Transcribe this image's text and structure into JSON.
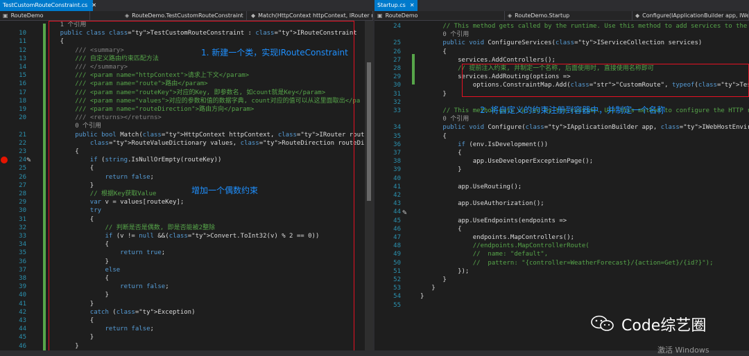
{
  "left": {
    "tab_title": "TestCustomRouteConstraint.cs",
    "nav_project": "RouteDemo",
    "nav_class": "RouteDemo.TestCustomRouteConstraint",
    "nav_method": "Match(HttpContext httpContext, IRouter route,",
    "lines": [
      {
        "n": "",
        "text": "1 个引用",
        "cls": "ref",
        "indent": 4
      },
      {
        "n": "10",
        "text": "public class TestCustomRouteConstraint : IRouteConstraint",
        "cls": "",
        "indent": 4
      },
      {
        "n": "11",
        "text": "{",
        "cls": "",
        "indent": 4
      },
      {
        "n": "12",
        "text": "/// <summary>",
        "cls": "xml",
        "indent": 8
      },
      {
        "n": "13",
        "text": "/// 自定义路由约束匹配方法",
        "cls": "cm",
        "indent": 8
      },
      {
        "n": "14",
        "text": "/// </summary>",
        "cls": "xml",
        "indent": 8
      },
      {
        "n": "15",
        "text": "/// <param name=\"httpContext\">请求上下文</param>",
        "cls": "cm",
        "indent": 8
      },
      {
        "n": "16",
        "text": "/// <param name=\"route\">路由</param>",
        "cls": "cm",
        "indent": 8
      },
      {
        "n": "17",
        "text": "/// <param name=\"routeKey\">对应的Key, 即参数名, 如count就是Key</param>",
        "cls": "cm",
        "indent": 8
      },
      {
        "n": "18",
        "text": "/// <param name=\"values\">对应的参数和值的数据字典, count对应的值可以从这里面取出</pa",
        "cls": "cm",
        "indent": 8
      },
      {
        "n": "19",
        "text": "/// <param name=\"routeDirection\">路由方向</param>",
        "cls": "cm",
        "indent": 8
      },
      {
        "n": "20",
        "text": "/// <returns></returns>",
        "cls": "xml",
        "indent": 8
      },
      {
        "n": "",
        "text": "0 个引用",
        "cls": "ref",
        "indent": 8
      },
      {
        "n": "21",
        "text": "public bool Match(HttpContext httpContext, IRouter route, string routeKey,",
        "cls": "",
        "indent": 8
      },
      {
        "n": "22",
        "text": "    RouteValueDictionary values, RouteDirection routeDirection)",
        "cls": "",
        "indent": 8
      },
      {
        "n": "23",
        "text": "{",
        "cls": "",
        "indent": 8
      },
      {
        "n": "24",
        "text": "if (string.IsNullOrEmpty(routeKey))",
        "cls": "",
        "indent": 12
      },
      {
        "n": "25",
        "text": "{",
        "cls": "",
        "indent": 12
      },
      {
        "n": "26",
        "text": "    return false;",
        "cls": "",
        "indent": 12
      },
      {
        "n": "27",
        "text": "}",
        "cls": "",
        "indent": 12
      },
      {
        "n": "28",
        "text": "// 根据Key获取Value",
        "cls": "cm",
        "indent": 12
      },
      {
        "n": "29",
        "text": "var v = values[routeKey];",
        "cls": "",
        "indent": 12
      },
      {
        "n": "30",
        "text": "try",
        "cls": "",
        "indent": 12
      },
      {
        "n": "31",
        "text": "{",
        "cls": "",
        "indent": 12
      },
      {
        "n": "32",
        "text": "    // 判断是否是偶数, 即是否能被2整除",
        "cls": "cm",
        "indent": 12
      },
      {
        "n": "33",
        "text": "    if (v != null &&(Convert.ToInt32(v) % 2 == 0))",
        "cls": "",
        "indent": 12
      },
      {
        "n": "34",
        "text": "    {",
        "cls": "",
        "indent": 12
      },
      {
        "n": "35",
        "text": "        return true;",
        "cls": "",
        "indent": 12
      },
      {
        "n": "36",
        "text": "    }",
        "cls": "",
        "indent": 12
      },
      {
        "n": "37",
        "text": "    else",
        "cls": "",
        "indent": 12
      },
      {
        "n": "38",
        "text": "    {",
        "cls": "",
        "indent": 12
      },
      {
        "n": "39",
        "text": "        return false;",
        "cls": "",
        "indent": 12
      },
      {
        "n": "40",
        "text": "    }",
        "cls": "",
        "indent": 12
      },
      {
        "n": "41",
        "text": "}",
        "cls": "",
        "indent": 12
      },
      {
        "n": "42",
        "text": "catch (Exception)",
        "cls": "",
        "indent": 12
      },
      {
        "n": "43",
        "text": "{",
        "cls": "",
        "indent": 12
      },
      {
        "n": "44",
        "text": "    return false;",
        "cls": "",
        "indent": 12
      },
      {
        "n": "45",
        "text": "}",
        "cls": "",
        "indent": 12
      },
      {
        "n": "46",
        "text": "}",
        "cls": "",
        "indent": 8
      }
    ],
    "annotation_1": "1. 新建一个类，实现IRouteConstraint",
    "annotation_2": "增加一个偶数约束"
  },
  "right": {
    "tab_title": "Startup.cs",
    "nav_project": "RouteDemo",
    "nav_class": "RouteDemo.Startup",
    "nav_method": "Configure(IApplicationBuilder app, IWebHost",
    "lines": [
      {
        "n": "24",
        "text": "// This method gets called by the runtime. Use this method to add services to the conta",
        "cls": "cm",
        "indent": 6
      },
      {
        "n": "",
        "text": "0 个引用",
        "cls": "ref",
        "indent": 6
      },
      {
        "n": "25",
        "text": "public void ConfigureServices(IServiceCollection services)",
        "cls": "",
        "indent": 6
      },
      {
        "n": "26",
        "text": "{",
        "cls": "",
        "indent": 6
      },
      {
        "n": "27",
        "text": "    services.AddControllers();",
        "cls": "",
        "indent": 6
      },
      {
        "n": "28",
        "text": "    // 提前注入约束, 并制定一个名称, 后面使用时, 直接使用名称即可",
        "cls": "cm",
        "indent": 6
      },
      {
        "n": "29",
        "text": "    services.AddRouting(options =>",
        "cls": "",
        "indent": 6
      },
      {
        "n": "30",
        "text": "        options.ConstraintMap.Add(\"CustomRoute\", typeof(TestCustomRouteConstraint));",
        "cls": "",
        "indent": 6
      },
      {
        "n": "31",
        "text": "}",
        "cls": "",
        "indent": 6
      },
      {
        "n": "32",
        "text": "",
        "cls": "",
        "indent": 6
      },
      {
        "n": "33",
        "text": "// This method gets called by the runtime. Use this method to configure the HTTP reques",
        "cls": "cm",
        "indent": 6
      },
      {
        "n": "",
        "text": "0 个引用",
        "cls": "ref",
        "indent": 6
      },
      {
        "n": "34",
        "text": "public void Configure(IApplicationBuilder app, IWebHostEnvironment env)",
        "cls": "",
        "indent": 6
      },
      {
        "n": "35",
        "text": "{",
        "cls": "",
        "indent": 6
      },
      {
        "n": "36",
        "text": "    if (env.IsDevelopment())",
        "cls": "",
        "indent": 6
      },
      {
        "n": "37",
        "text": "    {",
        "cls": "",
        "indent": 6
      },
      {
        "n": "38",
        "text": "        app.UseDeveloperExceptionPage();",
        "cls": "",
        "indent": 6
      },
      {
        "n": "39",
        "text": "    }",
        "cls": "",
        "indent": 6
      },
      {
        "n": "40",
        "text": "",
        "cls": "",
        "indent": 6
      },
      {
        "n": "41",
        "text": "    app.UseRouting();",
        "cls": "",
        "indent": 6
      },
      {
        "n": "42",
        "text": "",
        "cls": "",
        "indent": 6
      },
      {
        "n": "43",
        "text": "    app.UseAuthorization();",
        "cls": "",
        "indent": 6
      },
      {
        "n": "44",
        "text": "",
        "cls": "",
        "indent": 6
      },
      {
        "n": "45",
        "text": "    app.UseEndpoints(endpoints =>",
        "cls": "",
        "indent": 6
      },
      {
        "n": "46",
        "text": "    {",
        "cls": "",
        "indent": 6
      },
      {
        "n": "47",
        "text": "        endpoints.MapControllers();",
        "cls": "",
        "indent": 6
      },
      {
        "n": "48",
        "text": "        //endpoints.MapControllerRoute(",
        "cls": "cm",
        "indent": 6
      },
      {
        "n": "49",
        "text": "        //  name: \"default\",",
        "cls": "cm",
        "indent": 6
      },
      {
        "n": "50",
        "text": "        //  pattern: \"{controller=WeatherForecast}/{action=Get}/{id?}\");",
        "cls": "cm",
        "indent": 6
      },
      {
        "n": "51",
        "text": "    });",
        "cls": "",
        "indent": 6
      },
      {
        "n": "52",
        "text": "}",
        "cls": "",
        "indent": 6
      },
      {
        "n": "53",
        "text": "}",
        "cls": "",
        "indent": 3
      },
      {
        "n": "54",
        "text": "}",
        "cls": "",
        "indent": 0
      },
      {
        "n": "55",
        "text": "",
        "cls": "",
        "indent": 0
      }
    ],
    "annotation": "2. 将自定义的约束注册到容器中，并制定一个名称"
  },
  "watermark": "Code综艺圈",
  "activate_windows": "激活 Windows",
  "colors": {
    "keyword": "#569cd6",
    "type": "#4ec9b0",
    "string": "#d69d85",
    "comment": "#57a64a",
    "annotation": "#1e90ff",
    "highlight_box": "#e81123"
  }
}
